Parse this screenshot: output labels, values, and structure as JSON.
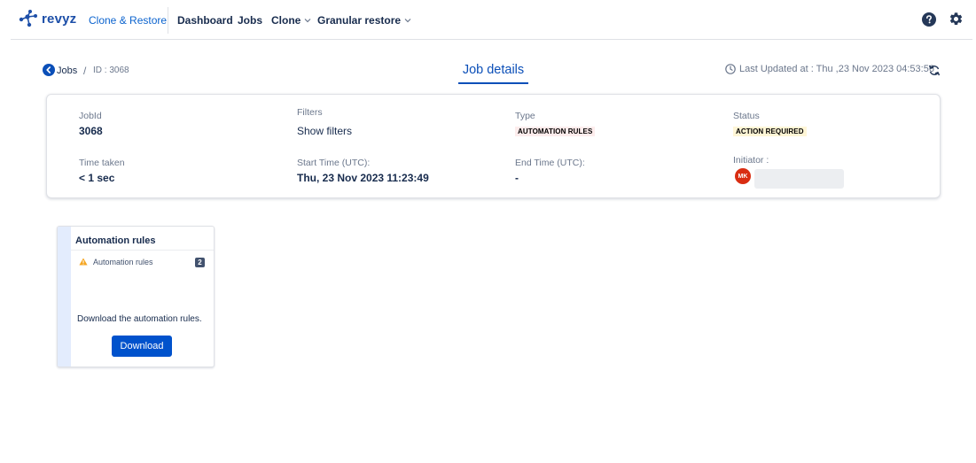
{
  "brand": {
    "name": "revyz",
    "product": "Clone & Restore",
    "accent": "#0b63ce"
  },
  "nav": {
    "items": [
      {
        "label": "Dashboard",
        "dropdown": false
      },
      {
        "label": "Jobs",
        "dropdown": false
      },
      {
        "label": "Clone",
        "dropdown": true
      },
      {
        "label": "Granular restore",
        "dropdown": true
      }
    ],
    "icons": [
      "help-icon",
      "gear-icon"
    ]
  },
  "breadcrumb": {
    "back": "Jobs",
    "separator": "/",
    "id": "ID : 3068"
  },
  "page_title": "Job details",
  "last_updated": "Last Updated at : Thu ,23 Nov 2023 04:53:56",
  "job": {
    "jobid_label": "JobId",
    "jobid_value": "3068",
    "filters_label": "Filters",
    "filters_link": "Show filters",
    "type_label": "Type",
    "type_value": "AUTOMATION RULES",
    "status_label": "Status",
    "status_value": "ACTION REQUIRED",
    "time_taken_label": "Time taken",
    "time_taken_value": "< 1 sec",
    "start_label": "Start Time (UTC):",
    "start_value": "Thu, 23 Nov 2023 11:23:49",
    "end_label": "End Time (UTC):",
    "end_value": "-",
    "initiator_label": "Initiator :",
    "initiator_initials": "MK"
  },
  "task": {
    "title": "Automation rules",
    "row_label": "Automation rules",
    "row_count": "2",
    "description": "Download the automation rules.",
    "button": "Download"
  }
}
